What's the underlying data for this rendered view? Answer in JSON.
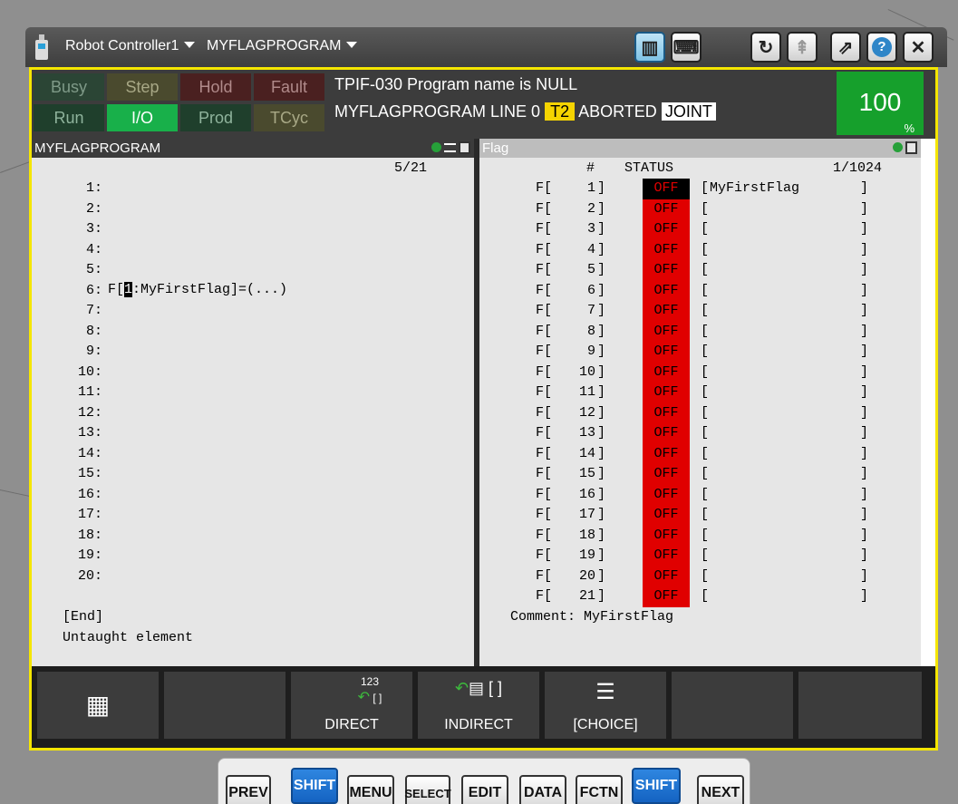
{
  "titlebar": {
    "controller": "Robot Controller1",
    "program": "MYFLAGPROGRAM",
    "icons": [
      "teach-pendant-icon",
      "tp-view-icon",
      "keyboard-icon",
      "refresh-icon",
      "jog-icon",
      "popout-icon",
      "help-icon",
      "close-icon"
    ]
  },
  "status": {
    "indicators": [
      {
        "label": "Busy",
        "row": 0
      },
      {
        "label": "Step",
        "row": 0
      },
      {
        "label": "Hold",
        "row": 0
      },
      {
        "label": "Fault",
        "row": 0
      },
      {
        "label": "Run",
        "row": 1
      },
      {
        "label": "I/O",
        "row": 1,
        "active": true
      },
      {
        "label": "Prod",
        "row": 1
      },
      {
        "label": "TCyc",
        "row": 1
      }
    ],
    "message": "TPIF-030  Program name is NULL",
    "line2_prog": "MYFLAGPROGRAM LINE 0",
    "mode": "T2",
    "state": "ABORTED",
    "coord": "JOINT",
    "override": "100",
    "override_unit": "%"
  },
  "left_panel": {
    "title": "MYFLAGPROGRAM",
    "position": "5/21",
    "lines": [
      "1:",
      "2:",
      "3:",
      "4:",
      "5:",
      "6:",
      "7:",
      "8:",
      "9:",
      "10:",
      "11:",
      "12:",
      "13:",
      "14:",
      "15:",
      "16:",
      "17:",
      "18:",
      "19:",
      "20:"
    ],
    "line5_pre": "F[",
    "line5_cursor": "1",
    "line5_post": ":MyFirstFlag]=(...)",
    "end": "[End]",
    "footer": "Untaught element"
  },
  "right_panel": {
    "title": "Flag",
    "col_num": "#",
    "col_status": "STATUS",
    "position": "1/1024",
    "rows": [
      {
        "n": "1",
        "s": "OFF",
        "c": "MyFirstFlag"
      },
      {
        "n": "2",
        "s": "OFF",
        "c": ""
      },
      {
        "n": "3",
        "s": "OFF",
        "c": ""
      },
      {
        "n": "4",
        "s": "OFF",
        "c": ""
      },
      {
        "n": "5",
        "s": "OFF",
        "c": ""
      },
      {
        "n": "6",
        "s": "OFF",
        "c": ""
      },
      {
        "n": "7",
        "s": "OFF",
        "c": ""
      },
      {
        "n": "8",
        "s": "OFF",
        "c": ""
      },
      {
        "n": "9",
        "s": "OFF",
        "c": ""
      },
      {
        "n": "10",
        "s": "OFF",
        "c": ""
      },
      {
        "n": "11",
        "s": "OFF",
        "c": ""
      },
      {
        "n": "12",
        "s": "OFF",
        "c": ""
      },
      {
        "n": "13",
        "s": "OFF",
        "c": ""
      },
      {
        "n": "14",
        "s": "OFF",
        "c": ""
      },
      {
        "n": "15",
        "s": "OFF",
        "c": ""
      },
      {
        "n": "16",
        "s": "OFF",
        "c": ""
      },
      {
        "n": "17",
        "s": "OFF",
        "c": ""
      },
      {
        "n": "18",
        "s": "OFF",
        "c": ""
      },
      {
        "n": "19",
        "s": "OFF",
        "c": ""
      },
      {
        "n": "20",
        "s": "OFF",
        "c": ""
      },
      {
        "n": "21",
        "s": "OFF",
        "c": ""
      }
    ],
    "footer": "Comment: MyFirstFlag"
  },
  "softkeys": [
    {
      "label": "",
      "icon": "grid-icon"
    },
    {
      "label": "",
      "icon": ""
    },
    {
      "label": "DIRECT",
      "icon": "direct-icon",
      "sup": "123"
    },
    {
      "label": "INDIRECT",
      "icon": "indirect-icon"
    },
    {
      "label": "[CHOICE]",
      "icon": "choice-icon"
    },
    {
      "label": "",
      "icon": ""
    },
    {
      "label": "",
      "icon": ""
    }
  ],
  "hardkeys": [
    "PREV",
    "SHIFT",
    "MENU",
    "SELECT",
    "EDIT",
    "DATA",
    "FCTN",
    "SHIFT",
    "NEXT"
  ]
}
